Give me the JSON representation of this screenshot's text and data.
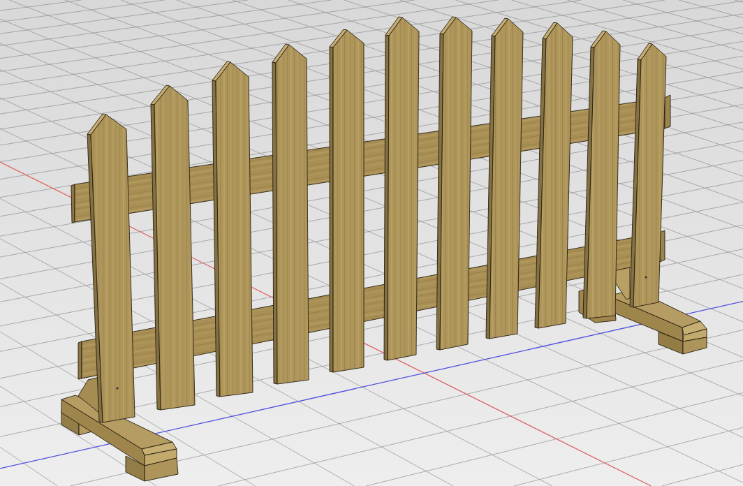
{
  "viewport": {
    "axes": [
      {
        "color": "#e06060"
      },
      {
        "color": "#4f4fe0"
      }
    ]
  }
}
